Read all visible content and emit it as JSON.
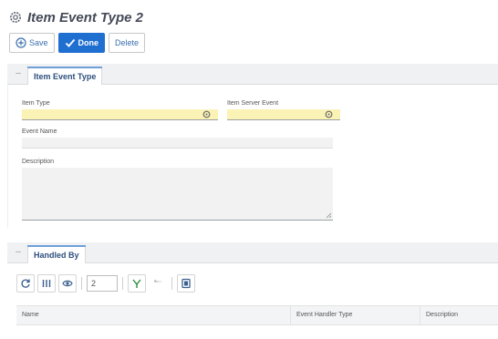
{
  "page": {
    "title": "Item Event Type 2",
    "title_icon": "gear-icon",
    "accent_color": "#1f6fd1",
    "required_field_color": "#fbf3b5"
  },
  "toolbar": {
    "save_label": "Save",
    "save_icon": "save-icon",
    "done_label": "Done",
    "done_icon": "checkmark-icon",
    "delete_label": "Delete"
  },
  "item_event_type_section": {
    "tab_label": "Item Event Type",
    "fields": {
      "item_type": {
        "label": "Item Type",
        "value": ""
      },
      "item_server_event": {
        "label": "Item Server Event",
        "value": ""
      },
      "event_name": {
        "label": "Event Name",
        "value": ""
      },
      "description": {
        "label": "Description",
        "value": ""
      }
    }
  },
  "handled_by_section": {
    "tab_label": "Handled By",
    "toolbar": {
      "page_size": "2",
      "icons": [
        "refresh-icon",
        "columns-icon",
        "view-icon",
        "add-relationship-icon",
        "disconnect-icon",
        "export-icon"
      ]
    },
    "grid": {
      "columns": [
        "Name",
        "Event Handler Type",
        "Description"
      ]
    }
  }
}
